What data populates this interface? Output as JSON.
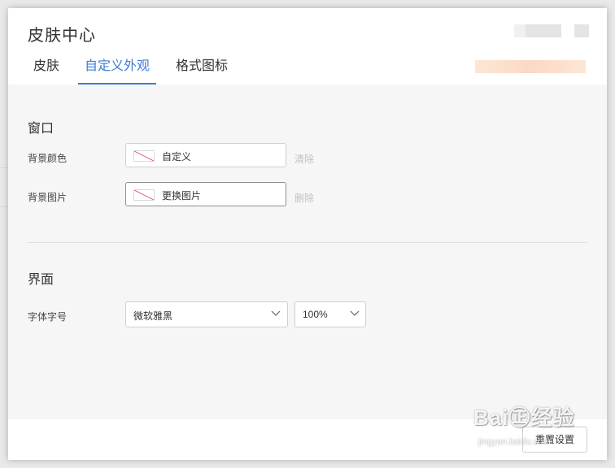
{
  "dialog": {
    "title": "皮肤中心"
  },
  "tabs": [
    {
      "label": "皮肤",
      "active": false
    },
    {
      "label": "自定义外观",
      "active": true
    },
    {
      "label": "格式图标",
      "active": false
    }
  ],
  "window_section": {
    "title": "窗口",
    "background_color": {
      "label": "背景颜色",
      "value": "自定义",
      "action": "清除"
    },
    "background_image": {
      "label": "背景图片",
      "value": "更换图片",
      "action": "删除"
    }
  },
  "ui_section": {
    "title": "界面",
    "font": {
      "label": "字体字号",
      "font_value": "微软雅黑",
      "size_value": "100%"
    }
  },
  "footer": {
    "reset_label": "重置设置"
  },
  "watermark": {
    "main": "Bai㊣经验",
    "sub": "jingyan.baidu.com"
  },
  "colors": {
    "accent": "#3d7bd7",
    "panel": "#f6f6f6",
    "no_color_slash": "#e05a6a"
  },
  "icons": {
    "none_swatch": "no-color-swatch-icon",
    "dropdown": "chevron-down-icon"
  }
}
